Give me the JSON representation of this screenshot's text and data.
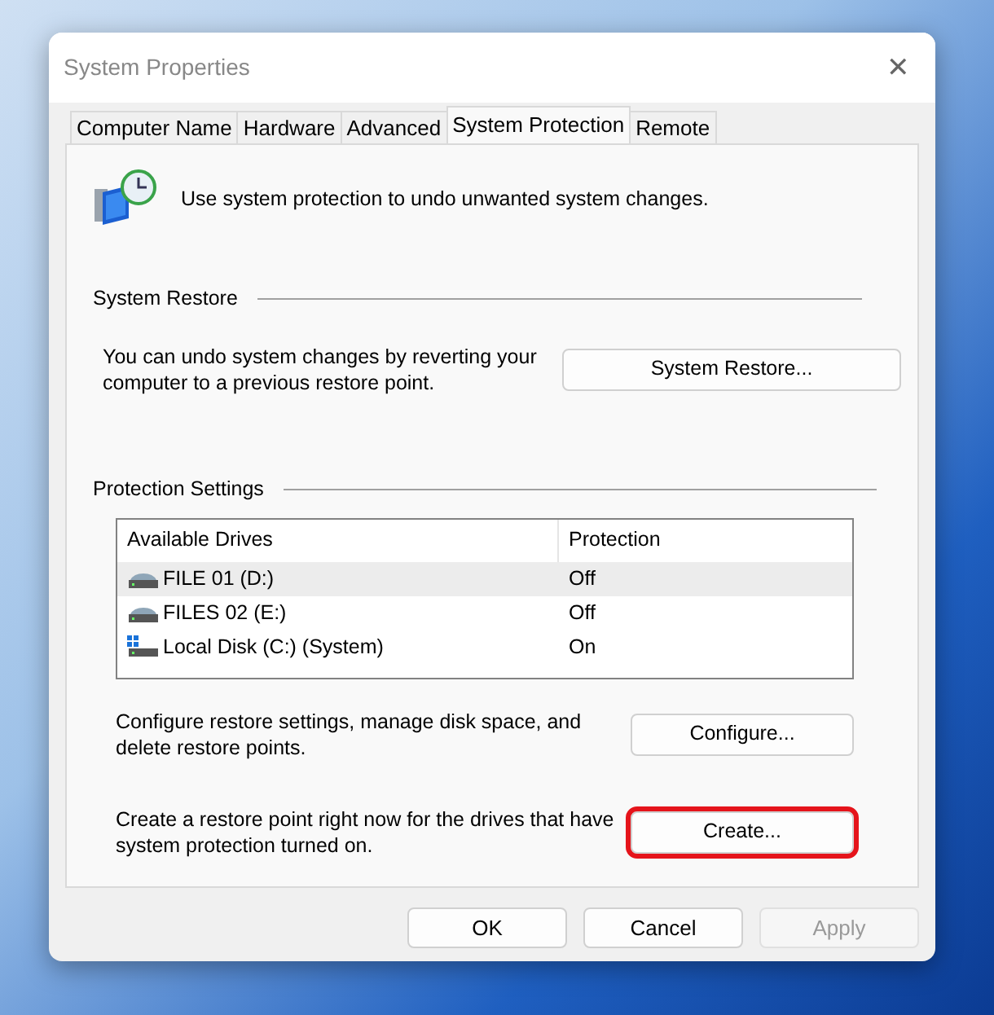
{
  "window": {
    "title": "System Properties",
    "close": "✕"
  },
  "tabs": [
    {
      "label": "Computer Name",
      "selected": false
    },
    {
      "label": "Hardware",
      "selected": false
    },
    {
      "label": "Advanced",
      "selected": false
    },
    {
      "label": "System Protection",
      "selected": true
    },
    {
      "label": "Remote",
      "selected": false
    }
  ],
  "intro": "Use system protection to undo unwanted system changes.",
  "system_restore": {
    "heading": "System Restore",
    "text": "You can undo system changes by reverting your computer to a previous restore point.",
    "button": "System Restore..."
  },
  "protection_settings": {
    "heading": "Protection Settings",
    "table": {
      "columns": [
        "Available Drives",
        "Protection"
      ],
      "rows": [
        {
          "kind": "drive",
          "drive": "FILE 01 (D:)",
          "protection": "Off",
          "selected": true
        },
        {
          "kind": "drive",
          "drive": "FILES 02 (E:)",
          "protection": "Off",
          "selected": false
        },
        {
          "kind": "system",
          "drive": "Local Disk (C:) (System)",
          "protection": "On",
          "selected": false
        }
      ]
    },
    "actions": [
      {
        "text": "Configure restore settings, manage disk space, and delete restore points.",
        "button": "Configure...",
        "highlighted": false
      },
      {
        "text": "Create a restore point right now for the drives that have system protection turned on.",
        "button": "Create...",
        "highlighted": true
      }
    ]
  },
  "buttons": [
    {
      "label": "OK",
      "disabled": false
    },
    {
      "label": "Cancel",
      "disabled": false
    },
    {
      "label": "Apply",
      "disabled": true
    }
  ]
}
